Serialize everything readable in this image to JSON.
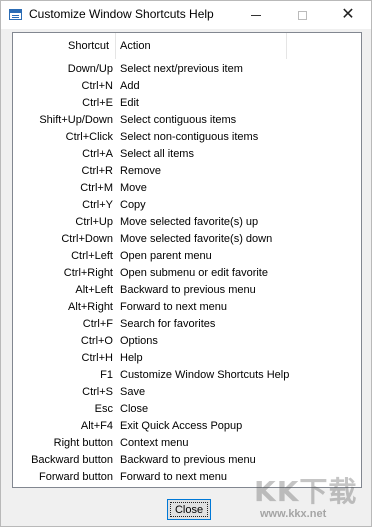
{
  "window": {
    "title": "Customize Window Shortcuts Help"
  },
  "table": {
    "headers": {
      "shortcut": "Shortcut",
      "action": "Action"
    },
    "rows": [
      {
        "key": "Down/Up",
        "action": "Select next/previous item"
      },
      {
        "key": "Ctrl+N",
        "action": "Add"
      },
      {
        "key": "Ctrl+E",
        "action": "Edit"
      },
      {
        "key": "Shift+Up/Down",
        "action": "Select contiguous items"
      },
      {
        "key": "Ctrl+Click",
        "action": "Select non-contiguous items"
      },
      {
        "key": "Ctrl+A",
        "action": "Select all items"
      },
      {
        "key": "Ctrl+R",
        "action": "Remove"
      },
      {
        "key": "Ctrl+M",
        "action": "Move"
      },
      {
        "key": "Ctrl+Y",
        "action": "Copy"
      },
      {
        "key": "Ctrl+Up",
        "action": "Move selected favorite(s) up"
      },
      {
        "key": "Ctrl+Down",
        "action": "Move selected favorite(s) down"
      },
      {
        "key": "Ctrl+Left",
        "action": "Open parent menu"
      },
      {
        "key": "Ctrl+Right",
        "action": "Open submenu or edit favorite"
      },
      {
        "key": "Alt+Left",
        "action": "Backward to previous menu"
      },
      {
        "key": "Alt+Right",
        "action": "Forward to next menu"
      },
      {
        "key": "Ctrl+F",
        "action": "Search for favorites"
      },
      {
        "key": "Ctrl+O",
        "action": "Options"
      },
      {
        "key": "Ctrl+H",
        "action": "Help"
      },
      {
        "key": "F1",
        "action": "Customize Window Shortcuts Help"
      },
      {
        "key": "Ctrl+S",
        "action": "Save"
      },
      {
        "key": "Esc",
        "action": "Close"
      },
      {
        "key": "Alt+F4",
        "action": "Exit Quick Access Popup"
      },
      {
        "key": "Right button",
        "action": "Context menu"
      },
      {
        "key": "Backward button",
        "action": "Backward to previous menu"
      },
      {
        "key": "Forward button",
        "action": "Forward to next menu"
      }
    ]
  },
  "buttons": {
    "close_label": "Close"
  },
  "icons": {
    "app": "window-icon",
    "minimize": "minimize-icon",
    "maximize": "maximize-icon",
    "close": "close-icon"
  },
  "watermark": {
    "logo": "KK下载",
    "url": "www.kkx.net"
  },
  "colors": {
    "focus_border": "#0078d7",
    "button_face": "#e1e1e1",
    "list_border": "#828790"
  }
}
